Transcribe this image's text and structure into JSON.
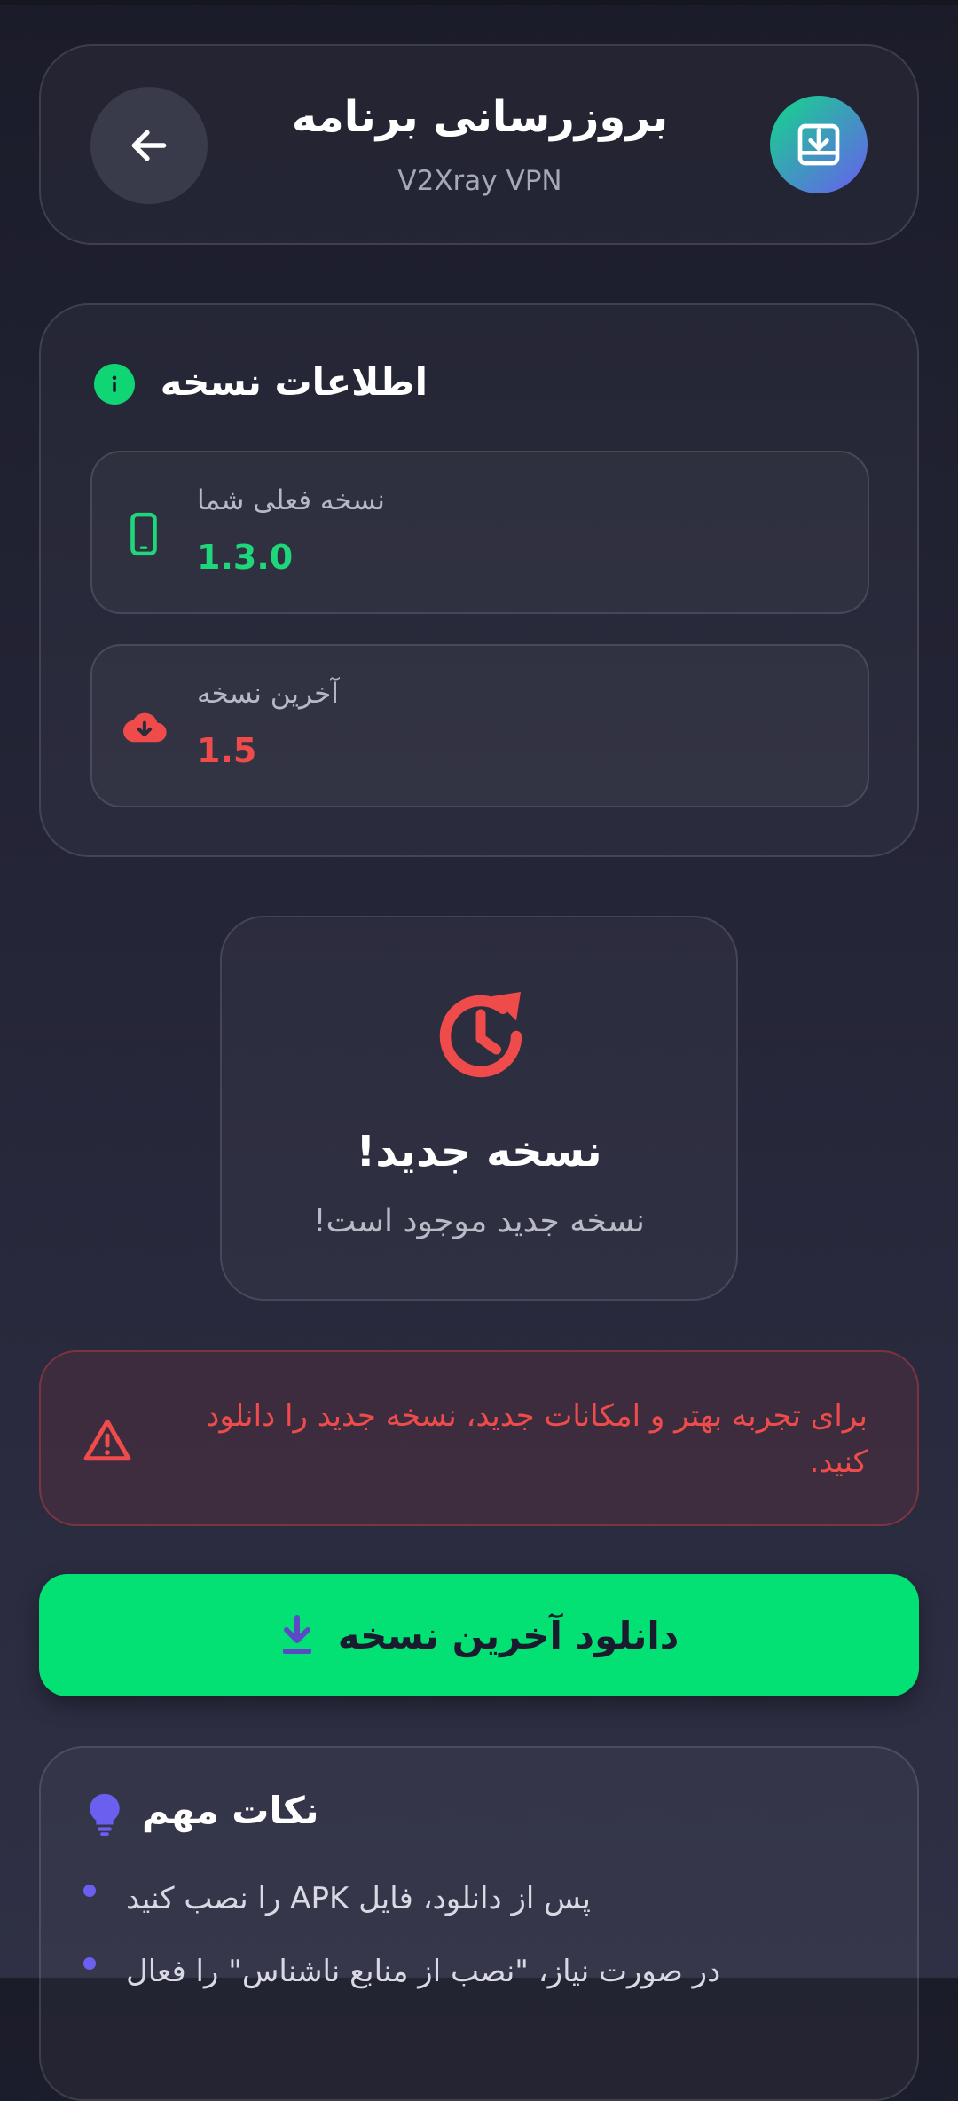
{
  "header": {
    "title": "بروزرسانی برنامه",
    "subtitle": "V2Xray VPN"
  },
  "version_info": {
    "section_title": "اطلاعات نسخه",
    "current_label": "نسخه فعلی شما",
    "current_value": "1.3.0",
    "latest_label": "آخرین نسخه",
    "latest_value": "1.5"
  },
  "status": {
    "title": "نسخه جدید!",
    "message": "نسخه جدید موجود است!"
  },
  "warning": {
    "text": "برای تجربه بهتر و امکانات جدید، نسخه جدید را دانلود کنید."
  },
  "download_button": {
    "label": "دانلود آخرین نسخه"
  },
  "tips": {
    "title": "نکات مهم",
    "items": [
      "را نصب کنید APK پس از دانلود، فایل",
      "در صورت نیاز، \"نصب از منابع ناشناس\" را فعال"
    ]
  },
  "colors": {
    "accent_green": "#03e175",
    "current_version": "#1fd67a",
    "latest_version": "#ef4b4b",
    "warning": "#ef4b4b",
    "bullet": "#6b5ff0"
  },
  "icons": {
    "back": "arrow-left-icon",
    "app": "download-box-icon",
    "info": "info-icon",
    "current": "phone-icon",
    "latest": "cloud-download-icon",
    "status": "clock-refresh-icon",
    "warning": "warning-triangle-icon",
    "download": "download-icon",
    "tips": "lightbulb-icon"
  }
}
